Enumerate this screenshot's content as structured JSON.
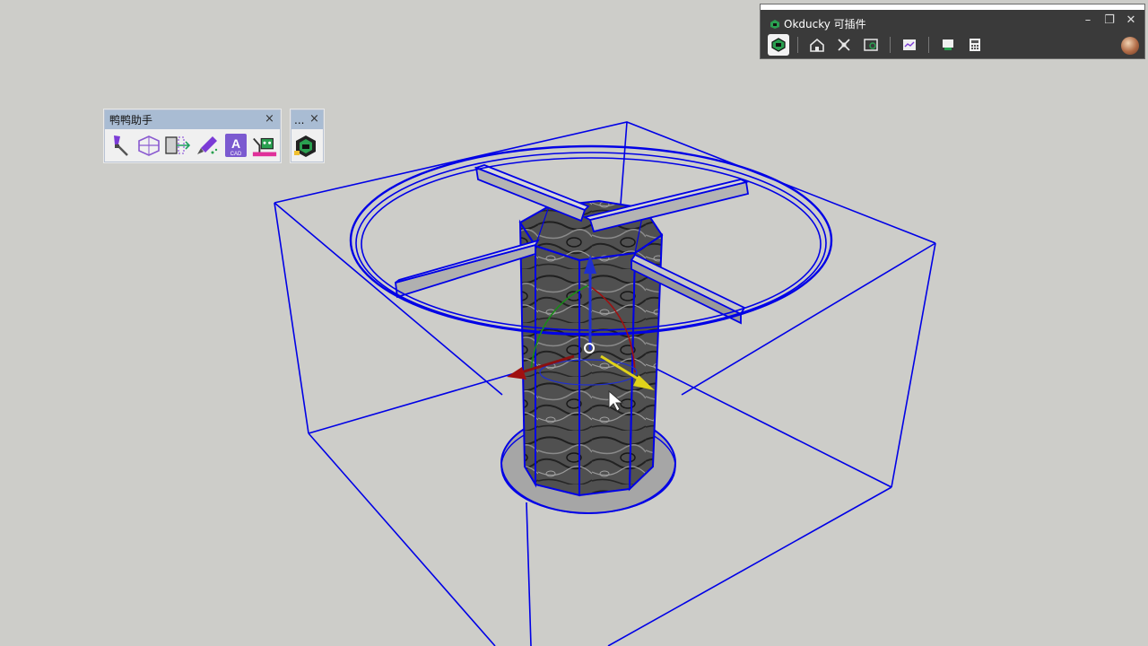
{
  "toolbar_ducky": {
    "title": "鸭鸭助手",
    "close_glyph": "×",
    "tools": [
      {
        "name": "paint-brush-icon"
      },
      {
        "name": "section-box-icon"
      },
      {
        "name": "extrude-arrow-icon"
      },
      {
        "name": "eyedropper-icon"
      },
      {
        "name": "cad-icon",
        "badge_letter": "A",
        "badge_sub": "CAD"
      },
      {
        "name": "robot-tool-icon"
      }
    ]
  },
  "toolbar_mini": {
    "title": "...",
    "close_glyph": "×",
    "tools": [
      {
        "name": "green-box-icon"
      }
    ]
  },
  "okducky_panel": {
    "title": "Okducky 可插件",
    "minimize_glyph": "–",
    "restore_glyph": "❐",
    "close_glyph": "✕",
    "tools": [
      {
        "name": "component-box-icon",
        "active": true
      },
      {
        "name": "house-icon"
      },
      {
        "name": "scale-arrows-icon"
      },
      {
        "name": "layers-cube-icon"
      },
      {
        "name": "chart-window-icon"
      },
      {
        "name": "stamp-icon"
      },
      {
        "name": "calculator-icon"
      }
    ],
    "avatar": "user-avatar"
  },
  "scene": {
    "selection_color": "#0000e6",
    "wood_color": "#4a4a4a",
    "ring_color": "#a6a6a6",
    "axis_colors": {
      "blue": "#1f2fd0",
      "red": "#a01010",
      "green": "#1a8a1a",
      "yellow": "#e0d21a"
    }
  }
}
